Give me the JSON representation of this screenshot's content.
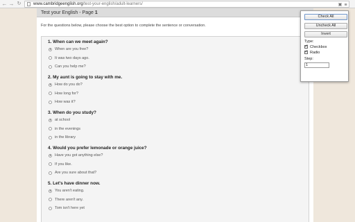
{
  "browser": {
    "url_domain": "www.cambridgeenglish.org",
    "url_path": "/test-your-english/adult-learners/",
    "back_icon": "back-arrow-icon",
    "forward_icon": "forward-arrow-icon",
    "reload_icon": "reload-icon",
    "menu_icon": "menu-icon"
  },
  "page": {
    "header_prefix": "Test your English - Page",
    "header_page": "1",
    "intro": "For the questions below, please choose the best option to complete the sentence or conversation.",
    "questions": [
      {
        "title": "1. When can we meet again?",
        "options": [
          "When are you free?",
          "It was two days ago.",
          "Can you help me?"
        ],
        "selected": 0
      },
      {
        "title": "2. My aunt is going to stay with me.",
        "options": [
          "How do you do?",
          "How long for?",
          "How was it?"
        ],
        "selected": 0
      },
      {
        "title": "3. When do you study?",
        "options": [
          "at school",
          "in the evenings",
          "in the library"
        ],
        "selected": 0
      },
      {
        "title": "4. Would you prefer lemonade or orange juice?",
        "options": [
          "Have you got anything else?",
          "If you like.",
          "Are you sure about that?"
        ],
        "selected": 0
      },
      {
        "title": "5. Let's have dinner now.",
        "options": [
          "You aren't eating.",
          "There aren't any.",
          "Tom isn't here yet"
        ],
        "selected": 0
      }
    ]
  },
  "popup": {
    "check_all": "Check All",
    "uncheck_all": "Uncheck All",
    "invert": "Invert",
    "type_label": "Type:",
    "checkbox_label": "Checkbox",
    "radio_label": "Radio",
    "checkbox_checked": true,
    "radio_checked": true,
    "step_label": "Step:",
    "step_value": "1"
  },
  "colors": {
    "background": "#efe7dc",
    "header_bar": "#dcdcdc",
    "question_box": "#f4f4f4",
    "primary_button_border": "#6e94c9"
  }
}
